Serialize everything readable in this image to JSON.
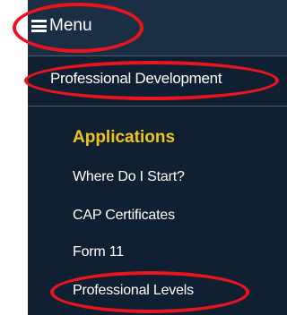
{
  "header": {
    "menu_label": "Menu",
    "menu_icon": "hamburger-icon",
    "background": "#1a2e44"
  },
  "nav": {
    "background": "#0f2033",
    "section_label": "Professional Development",
    "subsection_heading": "Applications",
    "heading_color": "#f2c418",
    "items": [
      {
        "label": "Where Do I Start?"
      },
      {
        "label": "CAP Certificates"
      },
      {
        "label": "Form 11"
      },
      {
        "label": "Professional Levels"
      }
    ]
  },
  "annotations": {
    "color": "#e8141f",
    "circled": [
      "Menu",
      "Professional Development",
      "Professional Levels"
    ]
  }
}
